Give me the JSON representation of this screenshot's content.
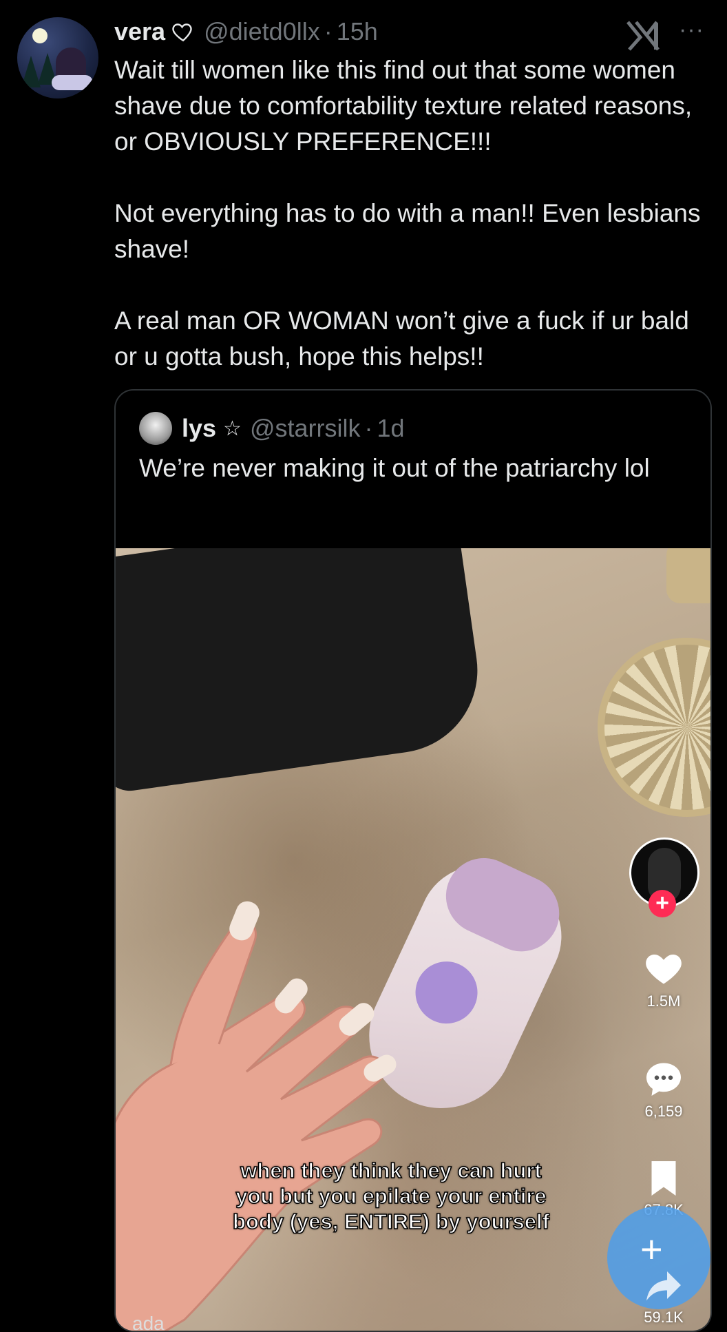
{
  "tweet": {
    "author_name": "vera",
    "author_handle": "@dietd0llx",
    "separator": "·",
    "time": "15h",
    "more_label": "···",
    "paragraphs": [
      "Wait till women like this find out that some women shave due to comfortability texture related reasons, or OBVIOUSLY PREFERENCE!!!",
      "Not everything has to do with a man!! Even lesbians shave!",
      "A real man OR WOMAN won’t give a fuck if ur bald or u gotta bush, hope this helps!!"
    ]
  },
  "quote": {
    "author_name": "lys",
    "star": "☆",
    "author_handle": "@starrsilk",
    "separator": "·",
    "time": "1d",
    "text": "We’re never making it out of the patriarchy lol",
    "video": {
      "caption": "when they think they can hurt you but you epilate your entire body (yes, ENTIRE) by yourself",
      "likes": "1.5M",
      "comments": "6,159",
      "saves": "67.8K",
      "shares": "59.1K",
      "follow_plus": "+",
      "fab_plus": "+",
      "corner_text": "ada"
    }
  },
  "colors": {
    "background": "#000000",
    "text": "#e7e9ea",
    "secondary": "#71767b",
    "border": "#2f3336",
    "follow_red": "#fe2c55",
    "fab_blue": "#4c9eeb"
  },
  "icons": [
    "heart-outline-icon",
    "x-logo-icon",
    "more-icon",
    "star-icon",
    "like-icon",
    "comment-icon",
    "bookmark-icon",
    "share-icon",
    "plus-icon"
  ]
}
